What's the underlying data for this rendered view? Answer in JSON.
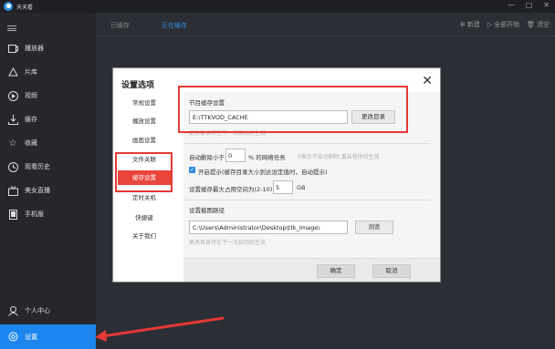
{
  "app": {
    "title": "天天看"
  },
  "window_controls": {
    "minimize": "—",
    "maximize": "□",
    "close": "✕"
  },
  "sidebar": {
    "items": [
      {
        "label": "播放器",
        "icon": "player-icon"
      },
      {
        "label": "片库",
        "icon": "home-icon"
      },
      {
        "label": "视频",
        "icon": "play-circle-icon"
      },
      {
        "label": "缓存",
        "icon": "download-icon"
      },
      {
        "label": "收藏",
        "icon": "star-icon"
      },
      {
        "label": "观看历史",
        "icon": "clock-icon"
      },
      {
        "label": "美女直播",
        "icon": "tv-icon"
      },
      {
        "label": "手机版",
        "icon": "phone-icon"
      },
      {
        "label": "个人中心",
        "icon": "user-icon"
      },
      {
        "label": "设置",
        "icon": "gear-icon"
      }
    ]
  },
  "tabs": [
    {
      "label": "已缓存"
    },
    {
      "label": "正在缓存"
    }
  ],
  "toolbar": {
    "new": "新建",
    "start_all": "全部开始",
    "clear": "清空"
  },
  "dialog": {
    "title": "设置选项",
    "nav": [
      "常规设置",
      "播放设置",
      "画面设置",
      "文件关联",
      "缓存设置",
      "定时关机",
      "快捷键",
      "关于我们"
    ],
    "cache_path_section": "节目缓存设置",
    "cache_path_value": "E:\\TTKVOD_CACHE",
    "change_dir_button": "更改目录",
    "change_dir_hint": "更改目录将在下一次启动后生效",
    "auto_delete_prefix": "自动删除小于",
    "auto_delete_value": "0",
    "auto_delete_suffix": "% 的网络任务",
    "auto_delete_hint": "0表示不自动删除,重启程序后生效",
    "notify_label": "开启提示(缓存目录大小到达设定值时，自动提示)",
    "max_space_label": "设置缓存最大占用空间为(2-10)",
    "max_space_value": "5",
    "max_space_unit": "GB",
    "screenshot_section": "设置截图路径",
    "screenshot_path": "C:\\Users\\Administrator\\Desktop\\ttk_Image\\",
    "browse_button": "浏览",
    "screenshot_hint": "更改目录将在下一次启动后生效",
    "ok_button": "确定",
    "cancel_button": "取消",
    "close_icon": "✕"
  },
  "colors": {
    "accent": "#1c86ee",
    "annotation": "#e53935"
  }
}
